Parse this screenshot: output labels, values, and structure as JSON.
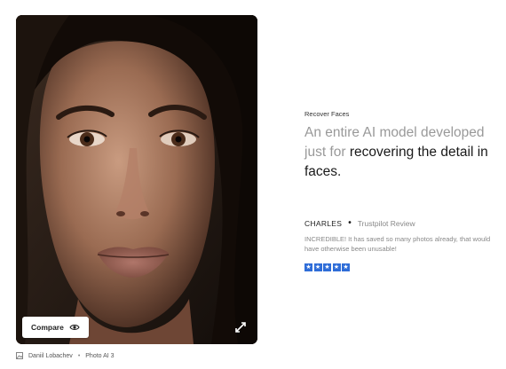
{
  "photo": {
    "compare_label": "Compare",
    "compare_icon": "eye-icon",
    "expand_icon": "expand-icon"
  },
  "caption": {
    "icon": "image-icon",
    "author": "Daniil Lobachev",
    "separator": "•",
    "product": "Photo AI 3"
  },
  "content": {
    "section_label": "Recover Faces",
    "headline_light": "An entire AI model developed just for ",
    "headline_dark": "recovering the detail in faces."
  },
  "review": {
    "name": "CHARLES",
    "bullet": "•",
    "source": "Trustpilot Review",
    "text": "INCREDIBLE! It has saved so many photos already, that would have otherwise been unusable!",
    "rating": 5,
    "star_glyph": "★",
    "star_color": "#2f6dd8"
  }
}
